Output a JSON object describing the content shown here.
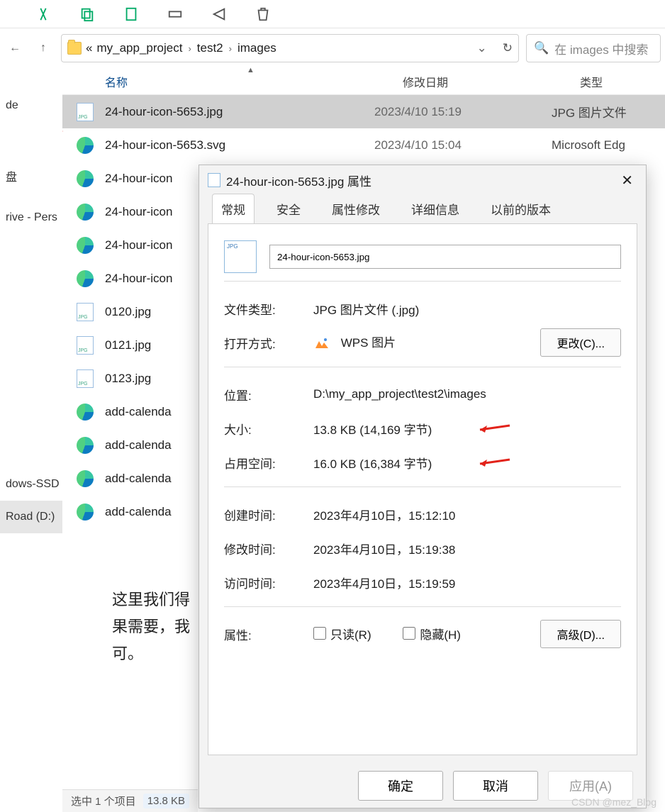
{
  "toolbar": {
    "icons": [
      "cut",
      "copy",
      "paste",
      "rename",
      "share",
      "delete"
    ]
  },
  "breadcrumb": {
    "ellipsis": "«",
    "seg1": "my_app_project",
    "seg2": "test2",
    "seg3": "images"
  },
  "search": {
    "placeholder": "在 images 中搜索"
  },
  "sidebar": {
    "items": [
      "de",
      "盘",
      "rive - Pers",
      "",
      "dows-SSD",
      "Road (D:)"
    ]
  },
  "headers": {
    "name": "名称",
    "date": "修改日期",
    "type": "类型"
  },
  "files": [
    {
      "icon": "jpg",
      "name": "24-hour-icon-5653.jpg",
      "date": "2023/4/10 15:19",
      "type": "JPG 图片文件",
      "selected": true
    },
    {
      "icon": "edge",
      "name": "24-hour-icon-5653.svg",
      "date": "2023/4/10 15:04",
      "type": "Microsoft Edg"
    },
    {
      "icon": "edge",
      "name": "24-hour-icon",
      "date": "",
      "type": ""
    },
    {
      "icon": "edge",
      "name": "24-hour-icon",
      "date": "",
      "type": ""
    },
    {
      "icon": "edge",
      "name": "24-hour-icon",
      "date": "",
      "type": ""
    },
    {
      "icon": "edge",
      "name": "24-hour-icon",
      "date": "",
      "type": ""
    },
    {
      "icon": "jpg",
      "name": "0120.jpg",
      "date": "",
      "type": ""
    },
    {
      "icon": "jpg",
      "name": "0121.jpg",
      "date": "",
      "type": ""
    },
    {
      "icon": "jpg",
      "name": "0123.jpg",
      "date": "",
      "type": ""
    },
    {
      "icon": "edge",
      "name": "add-calenda",
      "date": "",
      "type": ""
    },
    {
      "icon": "edge",
      "name": "add-calenda",
      "date": "",
      "type": ""
    },
    {
      "icon": "edge",
      "name": "add-calenda",
      "date": "",
      "type": ""
    },
    {
      "icon": "edge",
      "name": "add-calenda",
      "date": "",
      "type": ""
    }
  ],
  "status": {
    "selected": "选中 1 个项目",
    "size": "13.8 KB"
  },
  "below": {
    "l1": "这里我们得",
    "l2": "果需要，我",
    "l3": "可。"
  },
  "dialog": {
    "title": "24-hour-icon-5653.jpg 属性",
    "tabs": {
      "general": "常规",
      "security": "安全",
      "modify": "属性修改",
      "details": "详细信息",
      "previous": "以前的版本"
    },
    "filename": "24-hour-icon-5653.jpg",
    "filetype_label": "文件类型:",
    "filetype": "JPG 图片文件 (.jpg)",
    "openwith_label": "打开方式:",
    "openwith": "WPS 图片",
    "change_btn": "更改(C)...",
    "location_label": "位置:",
    "location": "D:\\my_app_project\\test2\\images",
    "size_label": "大小:",
    "size": "13.8 KB (14,169 字节)",
    "disk_label": "占用空间:",
    "disk": "16.0 KB (16,384 字节)",
    "created_label": "创建时间:",
    "created": "2023年4月10日，15:12:10",
    "modified_label": "修改时间:",
    "modified": "2023年4月10日，15:19:38",
    "accessed_label": "访问时间:",
    "accessed": "2023年4月10日，15:19:59",
    "attr_label": "属性:",
    "readonly": "只读(R)",
    "hidden": "隐藏(H)",
    "advanced": "高级(D)...",
    "ok": "确定",
    "cancel": "取消",
    "apply": "应用(A)"
  },
  "watermark": "CSDN @mez_Blog"
}
